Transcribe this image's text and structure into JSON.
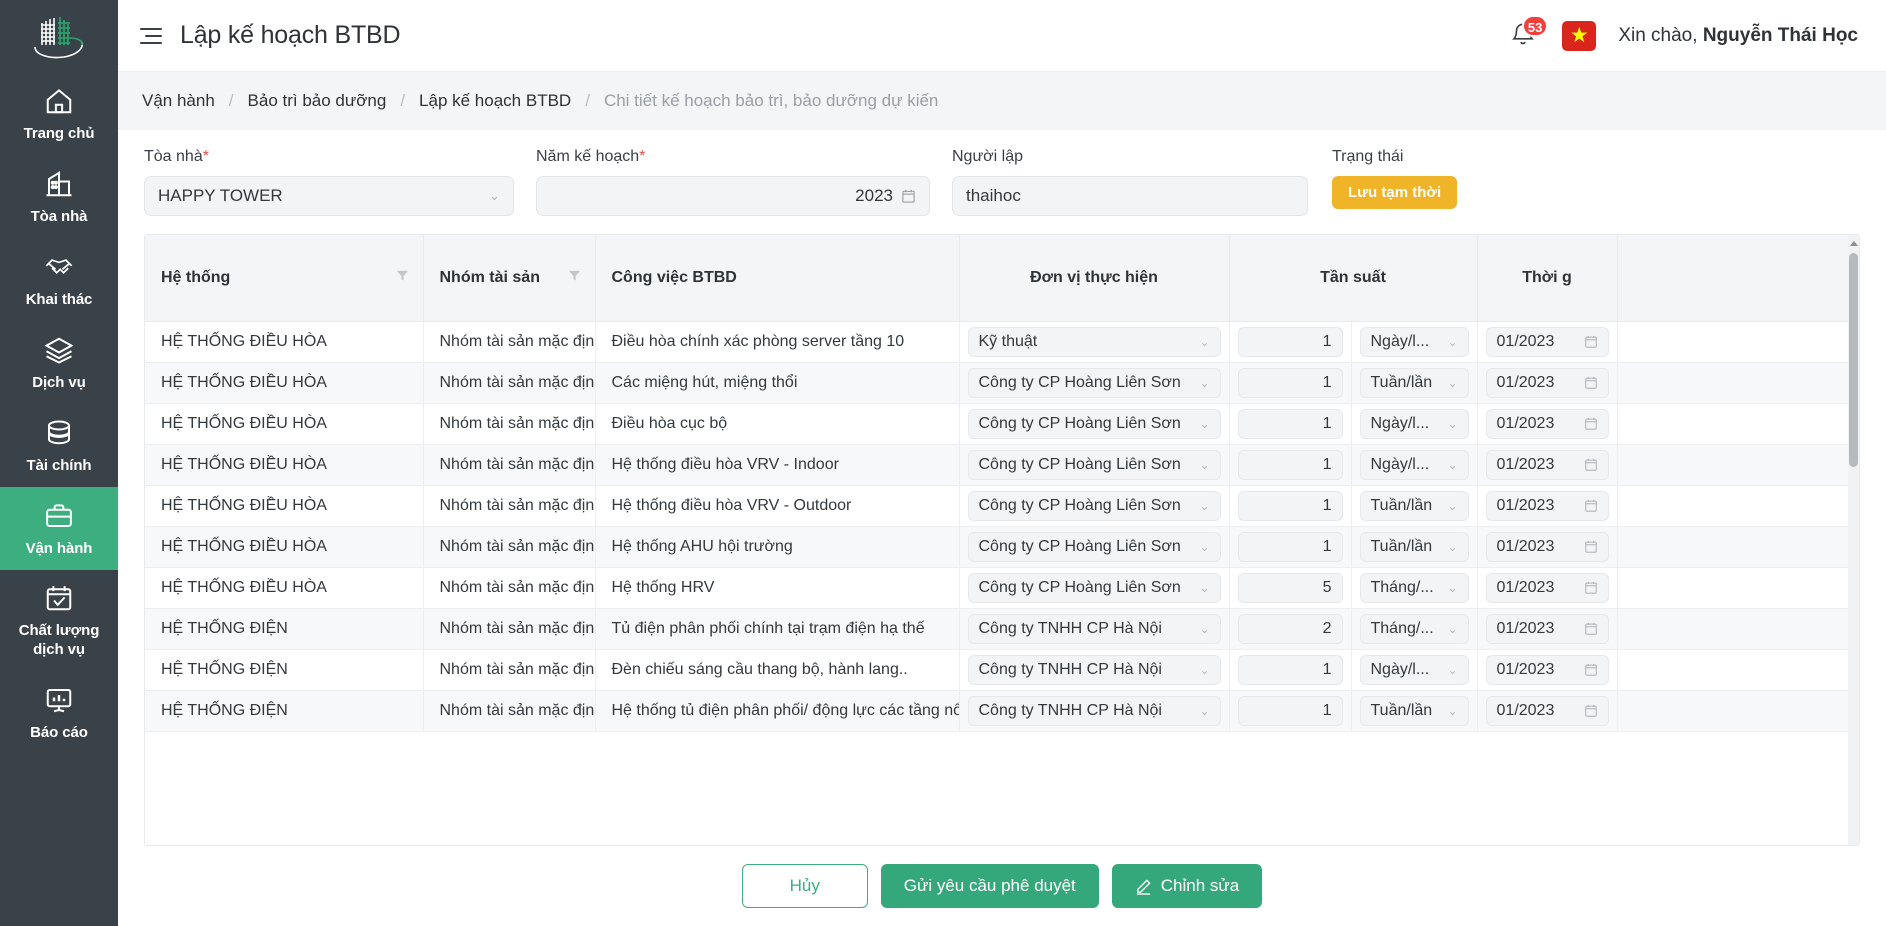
{
  "sidebar": {
    "logo_name": "building-logo",
    "items": [
      {
        "label": "Trang chủ",
        "icon": "home-icon",
        "active": false
      },
      {
        "label": "Tòa nhà",
        "icon": "building-icon",
        "active": false
      },
      {
        "label": "Khai thác",
        "icon": "handshake-icon",
        "active": false
      },
      {
        "label": "Dịch vụ",
        "icon": "layers-icon",
        "active": false
      },
      {
        "label": "Tài chính",
        "icon": "database-icon",
        "active": false
      },
      {
        "label": "Vận hành",
        "icon": "briefcase-icon",
        "active": true
      },
      {
        "label": "Chất lượng dịch vụ",
        "icon": "calendar-check-icon",
        "active": false
      },
      {
        "label": "Báo cáo",
        "icon": "presentation-chart-icon",
        "active": false
      }
    ]
  },
  "topbar": {
    "menu_icon": "hamburger-icon",
    "title": "Lập kế hoạch BTBD",
    "notification_icon": "bell-icon",
    "notification_count": "53",
    "language_flag": "vietnam-flag",
    "flag_star": "★",
    "greeting_prefix": "Xin chào, ",
    "user_name": "Nguyễn Thái Học"
  },
  "breadcrumb": {
    "separator": "/",
    "items": [
      "Vận hành",
      "Bảo trì bảo dưỡng",
      "Lập kế hoạch BTBD",
      "Chi tiết kế hoạch bảo trì, bảo dưỡng dự kiến"
    ]
  },
  "form": {
    "building": {
      "label": "Tòa nhà",
      "required": "*",
      "value": "HAPPY TOWER",
      "chevron": "⌄"
    },
    "year": {
      "label": "Năm kế hoạch",
      "required": "*",
      "value": "2023",
      "icon": "calendar-icon"
    },
    "creator": {
      "label": "Người lập",
      "required": "",
      "value": "thaihoc"
    },
    "status": {
      "label": "Trạng thái",
      "value": "Lưu tạm thời",
      "color": "#F0B429"
    }
  },
  "table": {
    "columns": [
      {
        "label": "Hệ thống",
        "filter": true,
        "align": "left"
      },
      {
        "label": "Nhóm tài sản",
        "filter": true,
        "align": "left"
      },
      {
        "label": "Công việc BTBD",
        "filter": false,
        "align": "left"
      },
      {
        "label": "Đơn vị thực hiện",
        "filter": false,
        "align": "center"
      },
      {
        "label": "Tần suất",
        "filter": false,
        "align": "center",
        "colspan": 2
      },
      {
        "label": "Thời g",
        "filter": false,
        "align": "center"
      }
    ],
    "rows": [
      {
        "system": "HỆ THỐNG ĐIỀU HÒA",
        "group": "Nhóm tài sản mặc định",
        "job": "Điều hòa chính xác phòng server tầng 10",
        "unit": "Kỹ thuật",
        "freq_num": "1",
        "freq_unit": "Ngày/l...",
        "time": "01/2023"
      },
      {
        "system": "HỆ THỐNG ĐIỀU HÒA",
        "group": "Nhóm tài sản mặc định",
        "job": "Các miệng hút, miệng thổi",
        "unit": "Công ty CP Hoàng Liên Sơn",
        "freq_num": "1",
        "freq_unit": "Tuần/lần",
        "time": "01/2023"
      },
      {
        "system": "HỆ THỐNG ĐIỀU HÒA",
        "group": "Nhóm tài sản mặc định",
        "job": "Điều hòa cục bộ",
        "unit": "Công ty CP Hoàng Liên Sơn",
        "freq_num": "1",
        "freq_unit": "Ngày/l...",
        "time": "01/2023"
      },
      {
        "system": "HỆ THỐNG ĐIỀU HÒA",
        "group": "Nhóm tài sản mặc định",
        "job": "Hệ thống điều hòa VRV - Indoor",
        "unit": "Công ty CP Hoàng Liên Sơn",
        "freq_num": "1",
        "freq_unit": "Ngày/l...",
        "time": "01/2023"
      },
      {
        "system": "HỆ THỐNG ĐIỀU HÒA",
        "group": "Nhóm tài sản mặc định",
        "job": "Hệ thống điều hòa VRV - Outdoor",
        "unit": "Công ty CP Hoàng Liên Sơn",
        "freq_num": "1",
        "freq_unit": "Tuần/lần",
        "time": "01/2023"
      },
      {
        "system": "HỆ THỐNG ĐIỀU HÒA",
        "group": "Nhóm tài sản mặc định",
        "job": "Hệ thống AHU hội trường",
        "unit": "Công ty CP Hoàng Liên Sơn",
        "freq_num": "1",
        "freq_unit": "Tuần/lần",
        "time": "01/2023"
      },
      {
        "system": "HỆ THỐNG ĐIỀU HÒA",
        "group": "Nhóm tài sản mặc định",
        "job": "Hệ thống HRV",
        "unit": "Công ty CP Hoàng Liên Sơn",
        "freq_num": "5",
        "freq_unit": "Tháng/...",
        "time": "01/2023"
      },
      {
        "system": "HỆ THỐNG ĐIỆN",
        "group": "Nhóm tài sản mặc định",
        "job": "Tủ điện phân phối chính tại trạm điện hạ thế",
        "unit": "Công ty TNHH CP Hà Nội",
        "freq_num": "2",
        "freq_unit": "Tháng/...",
        "time": "01/2023"
      },
      {
        "system": "HỆ THỐNG ĐIỆN",
        "group": "Nhóm tài sản mặc định",
        "job": "Đèn chiếu sáng cầu thang bộ, hành lang..",
        "unit": "Công ty TNHH CP Hà Nội",
        "freq_num": "1",
        "freq_unit": "Ngày/l...",
        "time": "01/2023"
      },
      {
        "system": "HỆ THỐNG ĐIỆN",
        "group": "Nhóm tài sản mặc định",
        "job": "Hệ thống tủ điện phân phối/ động lực các tầng nổi",
        "unit": "Công ty TNHH CP Hà Nội",
        "freq_num": "1",
        "freq_unit": "Tuần/lần",
        "time": "01/2023"
      }
    ]
  },
  "footer": {
    "cancel": "Hủy",
    "submit": "Gửi yêu cầu phê duyệt",
    "edit": "Chỉnh sửa",
    "edit_icon": "pencil-icon"
  },
  "colors": {
    "sidebar_bg": "#394149",
    "accent_green": "#35A87B",
    "active_green": "#3DAE80",
    "status_yellow": "#F0B429",
    "badge_red": "#F0403C",
    "flag_red": "#DA251D"
  }
}
